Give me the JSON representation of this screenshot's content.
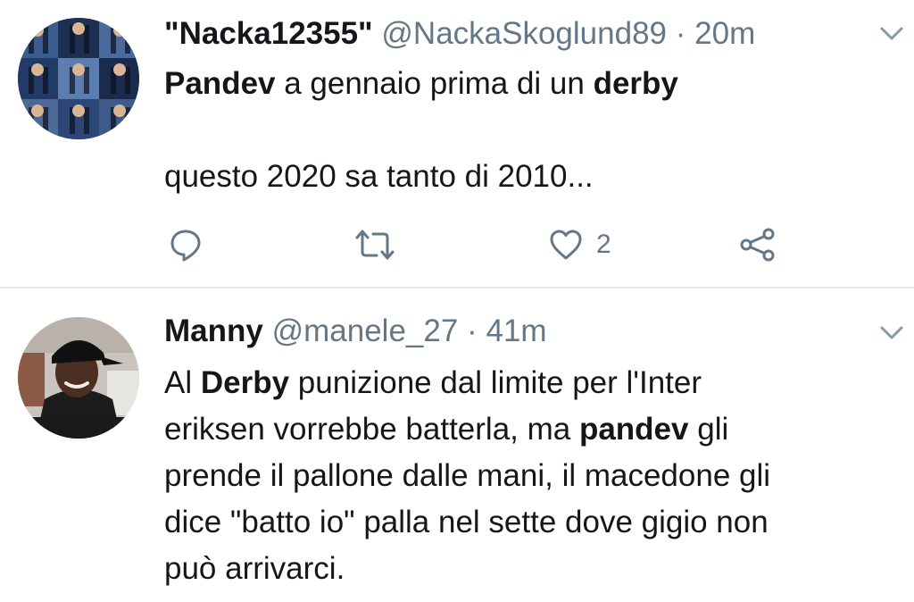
{
  "tweets": [
    {
      "display_name": "\"Nacka12355\"",
      "handle": "@NackaSkoglund89",
      "separator": "·",
      "time": "20m",
      "text_lines": [
        [
          {
            "t": "Pandev",
            "b": true
          },
          {
            "t": " a gennaio prima di un ",
            "b": false
          },
          {
            "t": "derby",
            "b": true
          }
        ],
        [],
        [
          {
            "t": "questo 2020 sa tanto di 2010...",
            "b": false
          }
        ]
      ],
      "actions": {
        "reply_icon": "reply-icon",
        "retweet_icon": "retweet-icon",
        "like_icon": "heart-icon",
        "like_count": "2",
        "share_icon": "share-icon"
      }
    },
    {
      "display_name": "Manny",
      "handle": "@manele_27",
      "separator": "·",
      "time": "41m",
      "text_lines": [
        [
          {
            "t": "Al ",
            "b": false
          },
          {
            "t": "Derby",
            "b": true
          },
          {
            "t": " punizione dal limite per l'Inter",
            "b": false
          }
        ],
        [
          {
            "t": "eriksen vorrebbe batterla, ma ",
            "b": false
          },
          {
            "t": "pandev",
            "b": true
          },
          {
            "t": " gli",
            "b": false
          }
        ],
        [
          {
            "t": "prende il pallone dalle mani, il macedone  gli",
            "b": false
          }
        ],
        [
          {
            "t": "dice \"batto io\" palla nel sette dove gigio non",
            "b": false
          }
        ],
        [
          {
            "t": "può arrivarci.",
            "b": false
          }
        ]
      ]
    }
  ],
  "colors": {
    "text": "#14171a",
    "secondary": "#657786",
    "divider": "#e6ecf0",
    "chevron": "#8899a6"
  }
}
